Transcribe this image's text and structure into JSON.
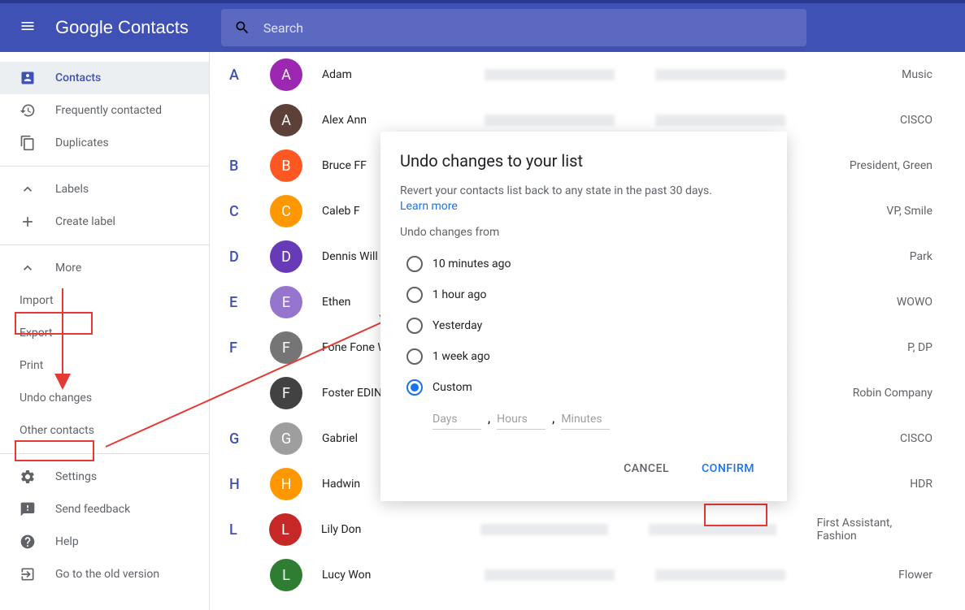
{
  "header": {
    "logo": "Google Contacts",
    "search_placeholder": "Search"
  },
  "sidebar": {
    "contacts": "Contacts",
    "frequently": "Frequently contacted",
    "duplicates": "Duplicates",
    "labels": "Labels",
    "create_label": "Create label",
    "more": "More",
    "import": "Import",
    "export": "Export",
    "print": "Print",
    "undo_changes": "Undo changes",
    "other_contacts": "Other contacts",
    "settings": "Settings",
    "send_feedback": "Send feedback",
    "help": "Help",
    "old_version": "Go to the old version"
  },
  "contacts": [
    {
      "letter": "A",
      "initial": "A",
      "name": "Adam",
      "color": "#9c27b0",
      "company": "Music"
    },
    {
      "letter": "",
      "initial": "A",
      "name": "Alex Ann",
      "color": "#5d4037",
      "company": "CISCO"
    },
    {
      "letter": "B",
      "initial": "B",
      "name": "Bruce FF",
      "color": "#ff5722",
      "company": "President, Green"
    },
    {
      "letter": "C",
      "initial": "C",
      "name": "Caleb F",
      "color": "#ff9800",
      "company": "VP, Smile"
    },
    {
      "letter": "D",
      "initial": "D",
      "name": "Dennis Will",
      "color": "#673ab7",
      "company": "Park"
    },
    {
      "letter": "E",
      "initial": "E",
      "name": "Ethen",
      "color": "#9575cd",
      "company": "WOWO"
    },
    {
      "letter": "F",
      "initial": "F",
      "name": "Fone Fone W",
      "color": "#757575",
      "company": "P, DP"
    },
    {
      "letter": "",
      "initial": "F",
      "name": "Foster EDIN",
      "color": "#424242",
      "company": "Robin Company"
    },
    {
      "letter": "G",
      "initial": "G",
      "name": "Gabriel",
      "color": "#9e9e9e",
      "company": "CISCO"
    },
    {
      "letter": "H",
      "initial": "H",
      "name": "Hadwin",
      "color": "#ff9800",
      "company": "HDR"
    },
    {
      "letter": "L",
      "initial": "L",
      "name": "Lily Don",
      "color": "#c62828",
      "company": "First Assistant, Fashion"
    },
    {
      "letter": "",
      "initial": "L",
      "name": "Lucy Won",
      "color": "#2e7d32",
      "company": "Flower"
    }
  ],
  "dialog": {
    "title": "Undo changes to your list",
    "description": "Revert your contacts list back to any state in the past 30 days.",
    "learn_more": "Learn more",
    "subtitle": "Undo changes from",
    "options": {
      "o1": "10 minutes ago",
      "o2": "1 hour ago",
      "o3": "Yesterday",
      "o4": "1 week ago",
      "o5": "Custom"
    },
    "custom": {
      "days": "Days",
      "hours": "Hours",
      "minutes": "Minutes",
      "comma": ","
    },
    "cancel": "CANCEL",
    "confirm": "CONFIRM"
  }
}
